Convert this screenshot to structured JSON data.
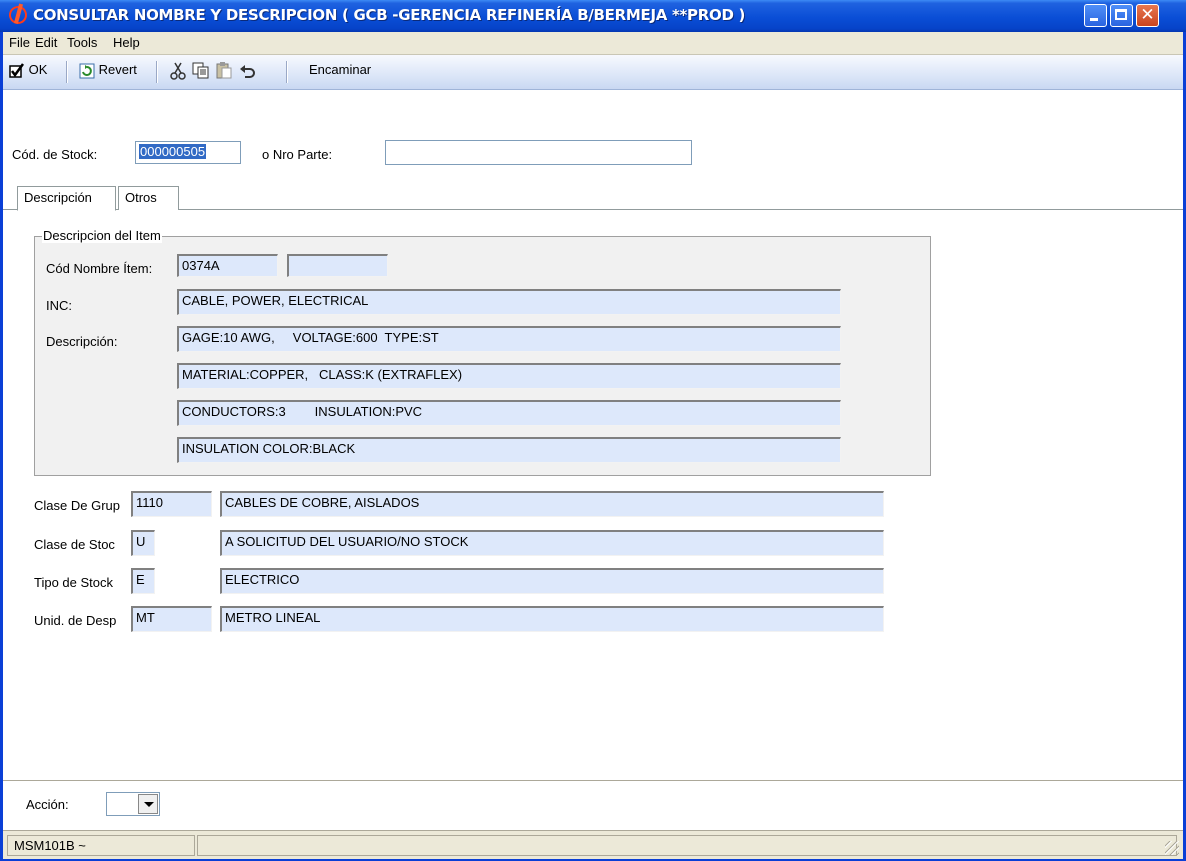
{
  "window": {
    "title": "CONSULTAR NOMBRE Y DESCRIPCION ( GCB -GERENCIA REFINERÍA B/BERMEJA **PROD )",
    "close_glyph": "✕"
  },
  "menu": [
    "File",
    "Edit",
    "Tools",
    "Help"
  ],
  "toolbar": {
    "ok_label": "OK",
    "revert_label": "Revert",
    "encaminar_label": "Encaminar"
  },
  "search": {
    "stock_code_label": "Cód. de Stock:",
    "stock_code_value": "000000505",
    "part_number_label": "o Nro Parte:",
    "part_number_value": ""
  },
  "tabs": [
    {
      "label": "Descripción",
      "active": true
    },
    {
      "label": "Otros",
      "active": false
    }
  ],
  "item_description": {
    "group_title": "Descripcion del Item",
    "name_code_label": "Cód Nombre Ítem:",
    "name_code_value": "0374A",
    "name_code_extra": "",
    "inc_label": "INC:",
    "inc_value": "CABLE, POWER, ELECTRICAL",
    "description_label": "Descripción:",
    "description_lines": [
      "GAGE:10 AWG,     VOLTAGE:600  TYPE:ST",
      "MATERIAL:COPPER,   CLASS:K (EXTRAFLEX)",
      "CONDUCTORS:3        INSULATION:PVC",
      "INSULATION COLOR:BLACK"
    ]
  },
  "classification": [
    {
      "label": "Clase De Grup",
      "code": "1110",
      "desc": "CABLES DE COBRE, AISLADOS"
    },
    {
      "label": "Clase de Stoc",
      "code": "U",
      "desc": "A SOLICITUD DEL USUARIO/NO STOCK"
    },
    {
      "label": "Tipo de Stock",
      "code": "E",
      "desc": "ELECTRICO"
    },
    {
      "label": "Unid. de Desp",
      "code": "MT",
      "desc": "METRO LINEAL"
    }
  ],
  "action": {
    "label": "Acción:",
    "value": ""
  },
  "status_bar": {
    "program": "MSM101B ~"
  },
  "colors": {
    "titlebar": "#0a4ed6",
    "readonly_field": "#dde8fb",
    "selection": "#316ac5"
  }
}
